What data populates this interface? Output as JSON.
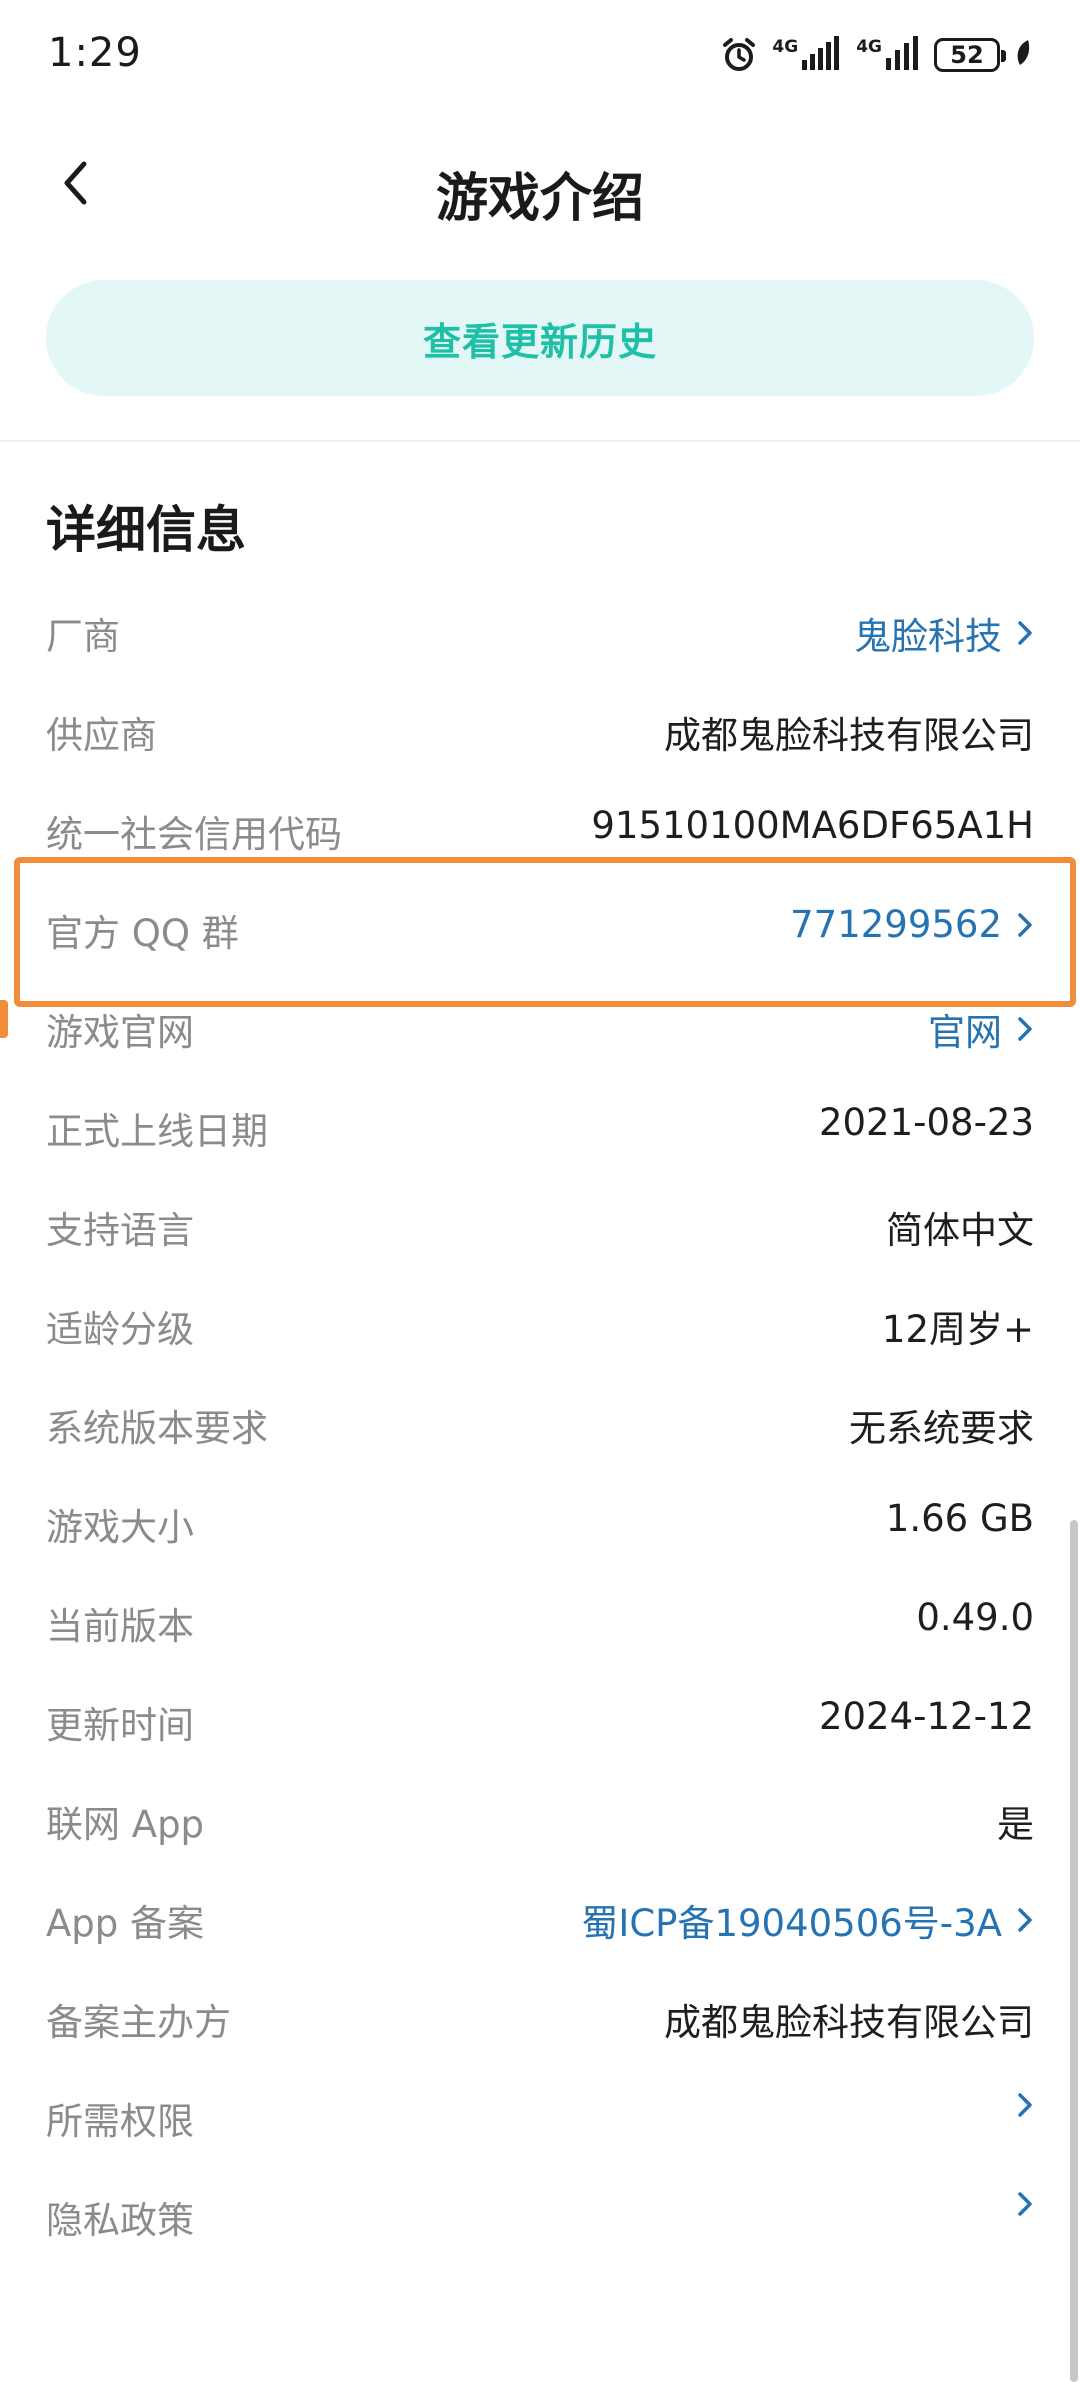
{
  "status_bar": {
    "time": "1:29",
    "net1": "4G",
    "net2": "4G",
    "battery": "52"
  },
  "header": {
    "title": "游戏介绍"
  },
  "history_button": {
    "label": "查看更新历史"
  },
  "section": {
    "title": "详细信息"
  },
  "rows": [
    {
      "label": "厂商",
      "value": "鬼脸科技",
      "link": true
    },
    {
      "label": "供应商",
      "value": "成都鬼脸科技有限公司",
      "link": false
    },
    {
      "label": "统一社会信用代码",
      "value": "91510100MA6DF65A1H",
      "link": false
    },
    {
      "label": "官方 QQ 群",
      "value": "771299562",
      "link": true
    },
    {
      "label": "游戏官网",
      "value": "官网",
      "link": true
    },
    {
      "label": "正式上线日期",
      "value": "2021-08-23",
      "link": false
    },
    {
      "label": "支持语言",
      "value": "简体中文",
      "link": false
    },
    {
      "label": "适龄分级",
      "value": "12周岁+",
      "link": false
    },
    {
      "label": "系统版本要求",
      "value": "无系统要求",
      "link": false
    },
    {
      "label": "游戏大小",
      "value": "1.66 GB",
      "link": false
    },
    {
      "label": "当前版本",
      "value": "0.49.0",
      "link": false
    },
    {
      "label": "更新时间",
      "value": "2024-12-12",
      "link": false
    },
    {
      "label": "联网 App",
      "value": "是",
      "link": false
    },
    {
      "label": "App 备案",
      "value": "蜀ICP备19040506号-3A",
      "link": true
    },
    {
      "label": "备案主办方",
      "value": "成都鬼脸科技有限公司",
      "link": false
    },
    {
      "label": "所需权限",
      "value": "",
      "link": true
    },
    {
      "label": "隐私政策",
      "value": "",
      "link": true
    }
  ],
  "colors": {
    "accent": "#1fbfa8",
    "accent_bg": "#e3f8f6",
    "link": "#2673b3",
    "label": "#8b8b8b",
    "highlight": "#f08c3a"
  },
  "icons": {
    "back": "chevron-left-icon",
    "row_link": "chevron-right-icon",
    "alarm": "alarm-icon",
    "signal": "signal-icon"
  }
}
